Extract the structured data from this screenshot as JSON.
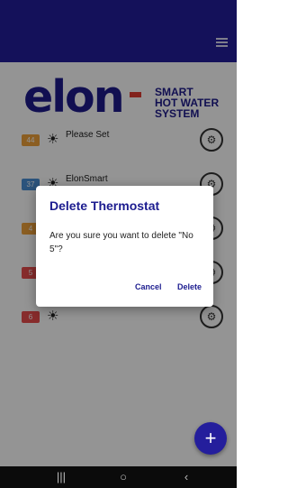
{
  "app": {
    "logo_text": "elon",
    "tagline": [
      "SMART",
      "HOT WATER",
      "SYSTEM"
    ]
  },
  "header": {
    "menu_icon": "hamburger-menu-icon"
  },
  "thermostats": [
    {
      "badge": "44",
      "badge_color": "#f0a23c",
      "name": "Please Set",
      "subtitle": "",
      "time": "",
      "mode_icon": "sun-icon"
    },
    {
      "badge": "37",
      "badge_color": "#4b8fd6",
      "name": "ElonSmart",
      "subtitle": "",
      "time": "",
      "mode_icon": "sun-icon"
    },
    {
      "badge": "4",
      "badge_color": "#f0a23c",
      "name": "",
      "subtitle": "",
      "time": "",
      "mode_icon": "sun-icon"
    },
    {
      "badge": "5",
      "badge_color": "#e84c4c",
      "name": "",
      "subtitle": "",
      "time": "",
      "mode_icon": "sun-icon"
    },
    {
      "badge": "6",
      "badge_color": "#e84c4c",
      "name": "",
      "subtitle": "",
      "time": "",
      "mode_icon": "sun-icon"
    }
  ],
  "dialog": {
    "title": "Delete Thermostat",
    "message": "Are you sure you want to delete \"No 5\"?",
    "cancel_label": "Cancel",
    "delete_label": "Delete"
  },
  "fab": {
    "label": "+"
  },
  "navigation": {
    "recents_glyph": "|||",
    "home_glyph": "○",
    "back_glyph": "‹"
  },
  "colors": {
    "primary": "#241e9c",
    "brand_text": "#1e1b8c",
    "accent_red": "#e03c31"
  }
}
